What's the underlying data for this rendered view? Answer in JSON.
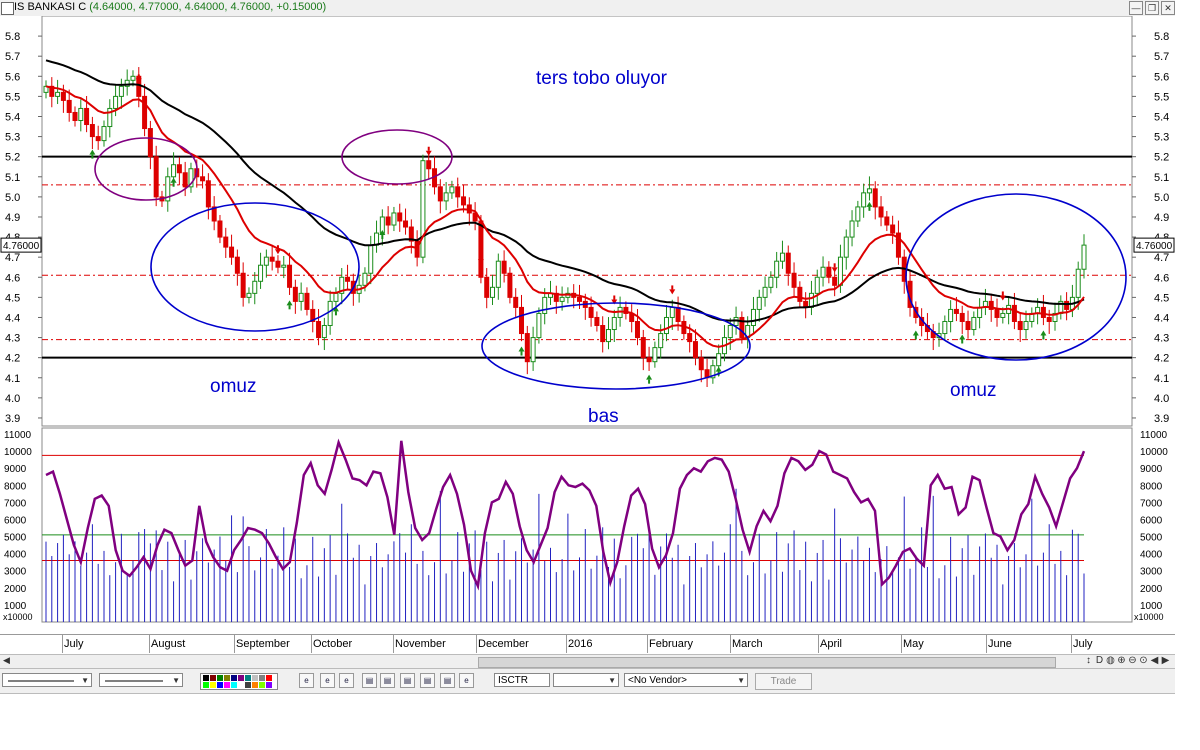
{
  "window": {
    "title_symbol": "IS BANKASI C",
    "title_quote": "(4.64000, 4.77000, 4.64000, 4.76000, +0.15000)"
  },
  "chart_data": [
    {
      "type": "candlestick",
      "y_ticks": [
        "5.8",
        "5.7",
        "5.6",
        "5.5",
        "5.4",
        "5.3",
        "5.2",
        "5.1",
        "5.0",
        "4.9",
        "4.8",
        "4.7",
        "4.6",
        "4.5",
        "4.4",
        "4.3",
        "4.2",
        "4.1",
        "4.0",
        "3.9"
      ],
      "ylim": [
        3.86,
        5.9
      ],
      "last_price_label": "4.76000",
      "x_month_labels": [
        "July",
        "August",
        "September",
        "October",
        "November",
        "December",
        "2016",
        "February",
        "March",
        "April",
        "May",
        "June",
        "July"
      ],
      "ohlc_close": [
        5.55,
        5.5,
        5.52,
        5.48,
        5.42,
        5.38,
        5.44,
        5.36,
        5.3,
        5.28,
        5.35,
        5.44,
        5.5,
        5.55,
        5.58,
        5.6,
        5.5,
        5.34,
        5.2,
        5.0,
        4.98,
        5.1,
        5.16,
        5.12,
        5.05,
        5.14,
        5.1,
        5.08,
        4.95,
        4.88,
        4.8,
        4.75,
        4.7,
        4.62,
        4.5,
        4.52,
        4.58,
        4.66,
        4.7,
        4.68,
        4.65,
        4.66,
        4.55,
        4.48,
        4.52,
        4.44,
        4.38,
        4.3,
        4.36,
        4.48,
        4.52,
        4.6,
        4.58,
        4.52,
        4.56,
        4.62,
        4.76,
        4.82,
        4.9,
        4.86,
        4.92,
        4.88,
        4.85,
        4.78,
        4.7,
        5.18,
        5.14,
        5.05,
        4.98,
        5.02,
        5.05,
        5.0,
        4.96,
        4.92,
        4.88,
        4.6,
        4.5,
        4.55,
        4.68,
        4.62,
        4.5,
        4.45,
        4.32,
        4.18,
        4.3,
        4.42,
        4.5,
        4.52,
        4.48,
        4.5,
        4.52,
        4.5,
        4.48,
        4.45,
        4.4,
        4.36,
        4.28,
        4.34,
        4.4,
        4.45,
        4.42,
        4.38,
        4.3,
        4.2,
        4.18,
        4.25,
        4.32,
        4.4,
        4.45,
        4.38,
        4.32,
        4.28,
        4.2,
        4.14,
        4.1,
        4.16,
        4.22,
        4.3,
        4.36,
        4.4,
        4.3,
        4.36,
        4.44,
        4.5,
        4.55,
        4.6,
        4.68,
        4.72,
        4.62,
        4.55,
        4.48,
        4.45,
        4.52,
        4.6,
        4.65,
        4.6,
        4.56,
        4.7,
        4.8,
        4.88,
        4.95,
        5.02,
        5.04,
        4.95,
        4.9,
        4.86,
        4.82,
        4.7,
        4.58,
        4.45,
        4.4,
        4.36,
        4.33,
        4.3,
        4.32,
        4.38,
        4.44,
        4.42,
        4.38,
        4.34,
        4.4,
        4.45,
        4.48,
        4.44,
        4.4,
        4.42,
        4.46,
        4.38,
        4.34,
        4.38,
        4.42,
        4.45,
        4.4,
        4.38,
        4.42,
        4.48,
        4.44,
        4.5,
        4.64,
        4.76
      ],
      "sma_fast_color": "#dd0000",
      "sma_slow_color": "#000000",
      "horizontal_lines": [
        {
          "value": 5.2,
          "color": "#000000",
          "style": "solid"
        },
        {
          "value": 4.2,
          "color": "#000000",
          "style": "solid"
        },
        {
          "value": 5.06,
          "color": "#dd0000",
          "style": "dashed"
        },
        {
          "value": 4.61,
          "color": "#dd0000",
          "style": "dashed"
        },
        {
          "value": 4.29,
          "color": "#dd0000",
          "style": "dashed"
        }
      ],
      "annotations": [
        {
          "text": "ters tobo oluyor",
          "color": "#0000cc"
        },
        {
          "text": "omuz",
          "color": "#0000cc"
        },
        {
          "text": "bas",
          "color": "#0000cc"
        },
        {
          "text": "omuz",
          "color": "#0000cc"
        }
      ],
      "ellipse_colors": [
        "#800080",
        "#0000cc"
      ]
    },
    {
      "type": "bar+line",
      "y_ticks": [
        "11000",
        "10000",
        "9000",
        "8000",
        "7000",
        "6000",
        "5000",
        "4000",
        "3000",
        "2000",
        "1000"
      ],
      "ylim": [
        0,
        11000
      ],
      "unit_label": "x10000",
      "volume_color": "#2020c0",
      "oscillator_color": "#800080",
      "oscillator": [
        8600,
        8800,
        7500,
        6000,
        4500,
        3500,
        5500,
        7200,
        7400,
        6800,
        4200,
        3000,
        2700,
        3200,
        3800,
        3100,
        4500,
        5400,
        5200,
        4200,
        3300,
        3600,
        6800,
        4700,
        3800,
        3200,
        3000,
        4200,
        4800,
        5500,
        5400,
        5200,
        4600,
        3800,
        3100,
        3500,
        5800,
        8600,
        9300,
        8000,
        7500,
        8900,
        10500,
        9500,
        8400,
        8300,
        8000,
        8800,
        8700,
        7300,
        5100,
        10600,
        7600,
        5500,
        4800,
        5200,
        6600,
        7900,
        8600,
        7500,
        5700,
        3000,
        2100,
        5200,
        7000,
        7200,
        8200,
        7500,
        5600,
        4200,
        3500,
        4500,
        5500,
        7600,
        8500,
        8000,
        7900,
        8100,
        7700,
        6800,
        4100,
        2300,
        3500,
        5600,
        7400,
        7800,
        6900,
        4300,
        3200,
        3900,
        5200,
        7800,
        8600,
        9000,
        8800,
        9400,
        9600,
        9500,
        8800,
        7200,
        5400,
        4100,
        5600,
        6500,
        5900,
        6800,
        8700,
        9600,
        9400,
        8900,
        9200,
        10000,
        9800,
        8800,
        8600,
        8400,
        7600,
        7000,
        7200,
        6500,
        2200,
        2600,
        3300,
        4100,
        4300,
        3700,
        3300,
        8000,
        8600,
        7800,
        7900,
        6300,
        6700,
        8500,
        8300,
        6700,
        5200,
        5000,
        4200,
        4800,
        6300,
        6900,
        8500,
        7500,
        6700,
        5600,
        7000,
        8400,
        9000,
        10000
      ]
    }
  ]
}
